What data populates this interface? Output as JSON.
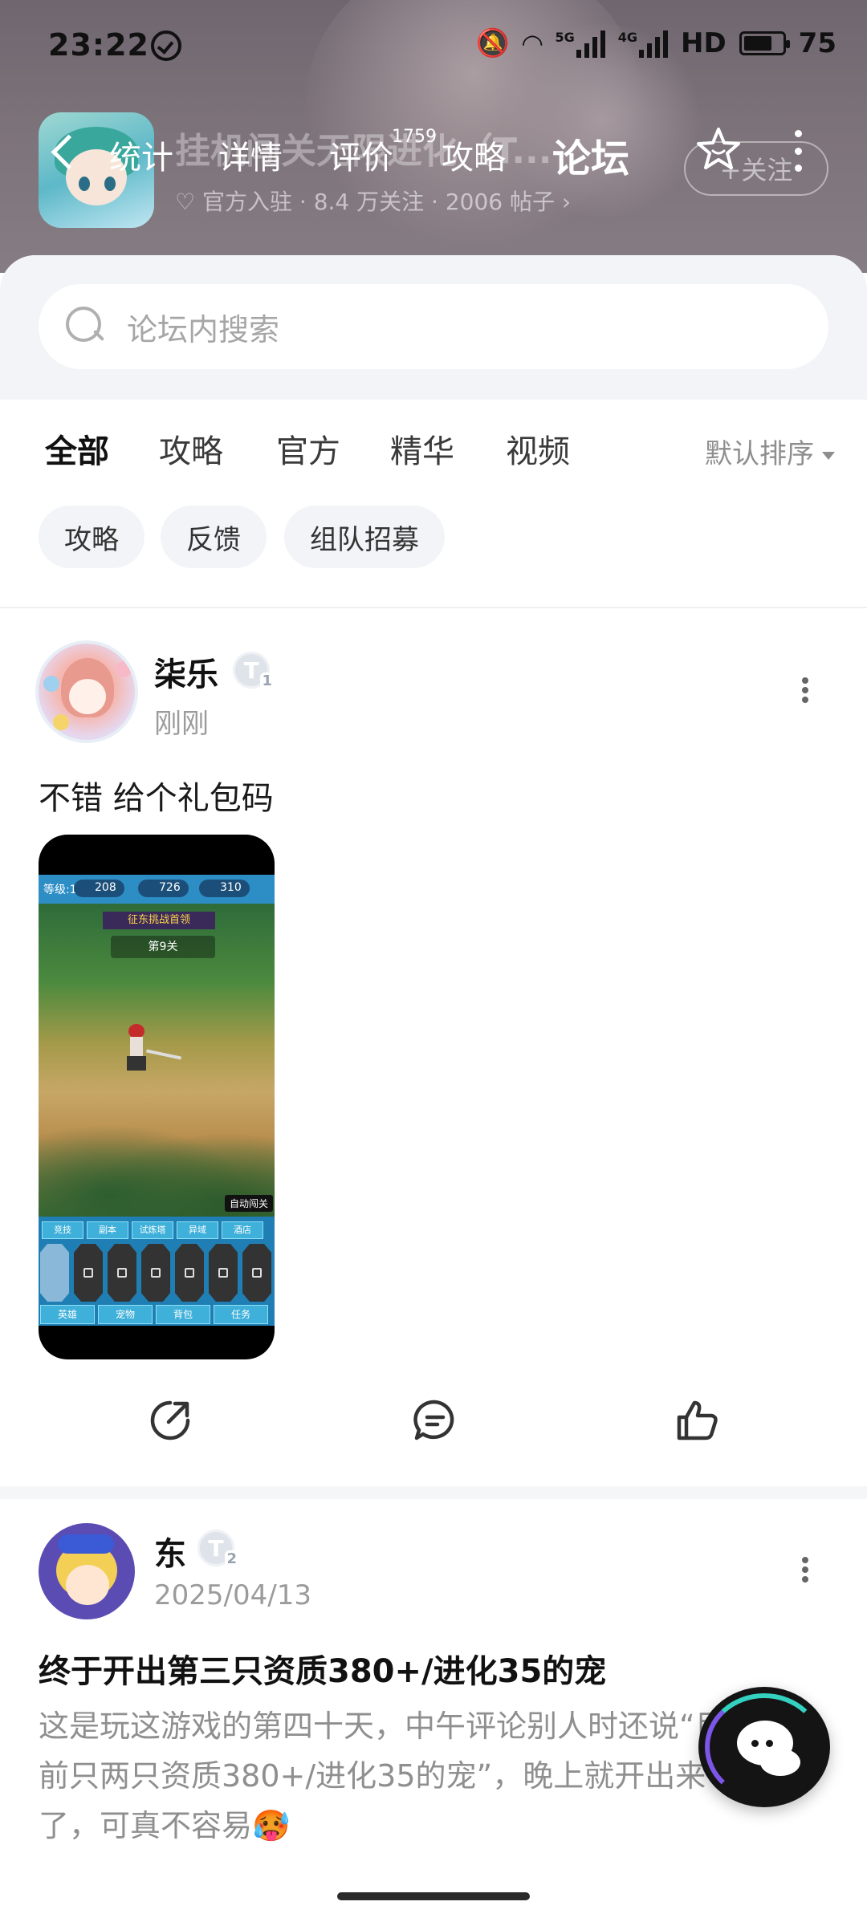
{
  "status_bar": {
    "time": "23:22",
    "network_5g": "5G",
    "network_4g": "4G",
    "hd": "HD",
    "battery": "75"
  },
  "game": {
    "title_partial": "挂机闯关无限进化（T...",
    "meta": "♡ 官方入驻 · 8.4 万关注 · 2006 帖子 ›",
    "follow_label": "+关注"
  },
  "nav": {
    "tabs": [
      {
        "label": "统计"
      },
      {
        "label": "详情"
      },
      {
        "label": "评价",
        "badge": "1759"
      },
      {
        "label": "攻略"
      },
      {
        "label": "论坛",
        "active": true
      }
    ]
  },
  "search": {
    "placeholder": "论坛内搜索"
  },
  "categories": {
    "items": [
      "全部",
      "攻略",
      "官方",
      "精华",
      "视频"
    ],
    "active": "全部",
    "sort_label": "默认排序"
  },
  "chips": [
    "攻略",
    "反馈",
    "组队招募"
  ],
  "posts": [
    {
      "author": "柒乐",
      "level": "T",
      "level_num": "1",
      "time": "刚刚",
      "text": "不错 给个礼包码",
      "image": {
        "level_text": "等级:10",
        "res1": "208",
        "res2": "726",
        "res3": "310",
        "banner": "征东挑战首领",
        "stage": "第9关",
        "auto": "自动闯关",
        "row1": [
          "竞技",
          "副本",
          "试炼塔",
          "异域",
          "酒店"
        ],
        "row2": [
          "英雄",
          "宠物",
          "背包",
          "任务"
        ]
      }
    },
    {
      "author": "东",
      "level": "T",
      "level_num": "2",
      "time": "2025/04/13",
      "title": "终于开出第三只资质380+/进化35的宠",
      "excerpt": "这是玩这游戏的第四十天，中午评论别人时还说“目前只两只资质380+/进化35的宠”，晚上就开出来了，可真不容易🥵"
    }
  ],
  "colors": {
    "accent": "#16c2ab"
  }
}
